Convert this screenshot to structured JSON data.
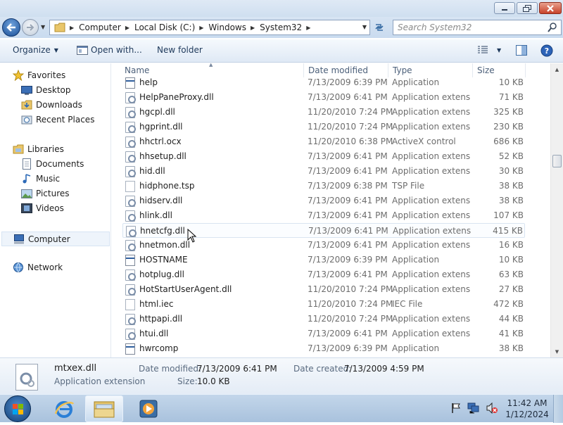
{
  "address": {
    "crumbs": [
      "Computer",
      "Local Disk (C:)",
      "Windows",
      "System32"
    ],
    "search_placeholder": "Search System32"
  },
  "toolbar": {
    "organize_label": "Organize",
    "openwith_label": "Open with...",
    "newfolder_label": "New folder"
  },
  "nav": {
    "favorites": "Favorites",
    "desktop": "Desktop",
    "downloads": "Downloads",
    "recent": "Recent Places",
    "libraries": "Libraries",
    "documents": "Documents",
    "music": "Music",
    "pictures": "Pictures",
    "videos": "Videos",
    "computer": "Computer",
    "network": "Network"
  },
  "columns": {
    "name": "Name",
    "date": "Date modified",
    "type": "Type",
    "size": "Size"
  },
  "files": [
    {
      "name": "help",
      "date": "7/13/2009 6:39 PM",
      "type": "Application",
      "size": "10 KB",
      "icon": "exe"
    },
    {
      "name": "HelpPaneProxy.dll",
      "date": "7/13/2009 6:41 PM",
      "type": "Application extens...",
      "size": "71 KB",
      "icon": "dll"
    },
    {
      "name": "hgcpl.dll",
      "date": "11/20/2010 7:24 PM",
      "type": "Application extens...",
      "size": "325 KB",
      "icon": "dll"
    },
    {
      "name": "hgprint.dll",
      "date": "11/20/2010 7:24 PM",
      "type": "Application extens...",
      "size": "230 KB",
      "icon": "dll"
    },
    {
      "name": "hhctrl.ocx",
      "date": "11/20/2010 6:38 PM",
      "type": "ActiveX control",
      "size": "686 KB",
      "icon": "dll"
    },
    {
      "name": "hhsetup.dll",
      "date": "7/13/2009 6:41 PM",
      "type": "Application extens...",
      "size": "52 KB",
      "icon": "dll"
    },
    {
      "name": "hid.dll",
      "date": "7/13/2009 6:41 PM",
      "type": "Application extens...",
      "size": "30 KB",
      "icon": "dll"
    },
    {
      "name": "hidphone.tsp",
      "date": "7/13/2009 6:38 PM",
      "type": "TSP File",
      "size": "38 KB",
      "icon": "page"
    },
    {
      "name": "hidserv.dll",
      "date": "7/13/2009 6:41 PM",
      "type": "Application extens...",
      "size": "38 KB",
      "icon": "dll"
    },
    {
      "name": "hlink.dll",
      "date": "7/13/2009 6:41 PM",
      "type": "Application extens...",
      "size": "107 KB",
      "icon": "dll"
    },
    {
      "name": "hnetcfg.dll",
      "date": "7/13/2009 6:41 PM",
      "type": "Application extens...",
      "size": "415 KB",
      "icon": "dll"
    },
    {
      "name": "hnetmon.dll",
      "date": "7/13/2009 6:41 PM",
      "type": "Application extens...",
      "size": "16 KB",
      "icon": "dll"
    },
    {
      "name": "HOSTNAME",
      "date": "7/13/2009 6:39 PM",
      "type": "Application",
      "size": "10 KB",
      "icon": "exe"
    },
    {
      "name": "hotplug.dll",
      "date": "7/13/2009 6:41 PM",
      "type": "Application extens...",
      "size": "63 KB",
      "icon": "dll"
    },
    {
      "name": "HotStartUserAgent.dll",
      "date": "11/20/2010 7:24 PM",
      "type": "Application extens...",
      "size": "27 KB",
      "icon": "dll"
    },
    {
      "name": "html.iec",
      "date": "11/20/2010 7:24 PM",
      "type": "IEC File",
      "size": "472 KB",
      "icon": "page"
    },
    {
      "name": "httpapi.dll",
      "date": "11/20/2010 7:24 PM",
      "type": "Application extens...",
      "size": "44 KB",
      "icon": "dll"
    },
    {
      "name": "htui.dll",
      "date": "7/13/2009 6:41 PM",
      "type": "Application extens...",
      "size": "41 KB",
      "icon": "dll"
    },
    {
      "name": "hwrcomp",
      "date": "7/13/2009 6:39 PM",
      "type": "Application",
      "size": "38 KB",
      "icon": "exe"
    }
  ],
  "details": {
    "name": "mtxex.dll",
    "type": "Application extension",
    "modified_label": "Date modified:",
    "modified_value": "7/13/2009 6:41 PM",
    "created_label": "Date created:",
    "created_value": "7/13/2009 4:59 PM",
    "size_label": "Size:",
    "size_value": "10.0 KB"
  },
  "clock": {
    "time": "11:42 AM",
    "date": "1/12/2024"
  }
}
